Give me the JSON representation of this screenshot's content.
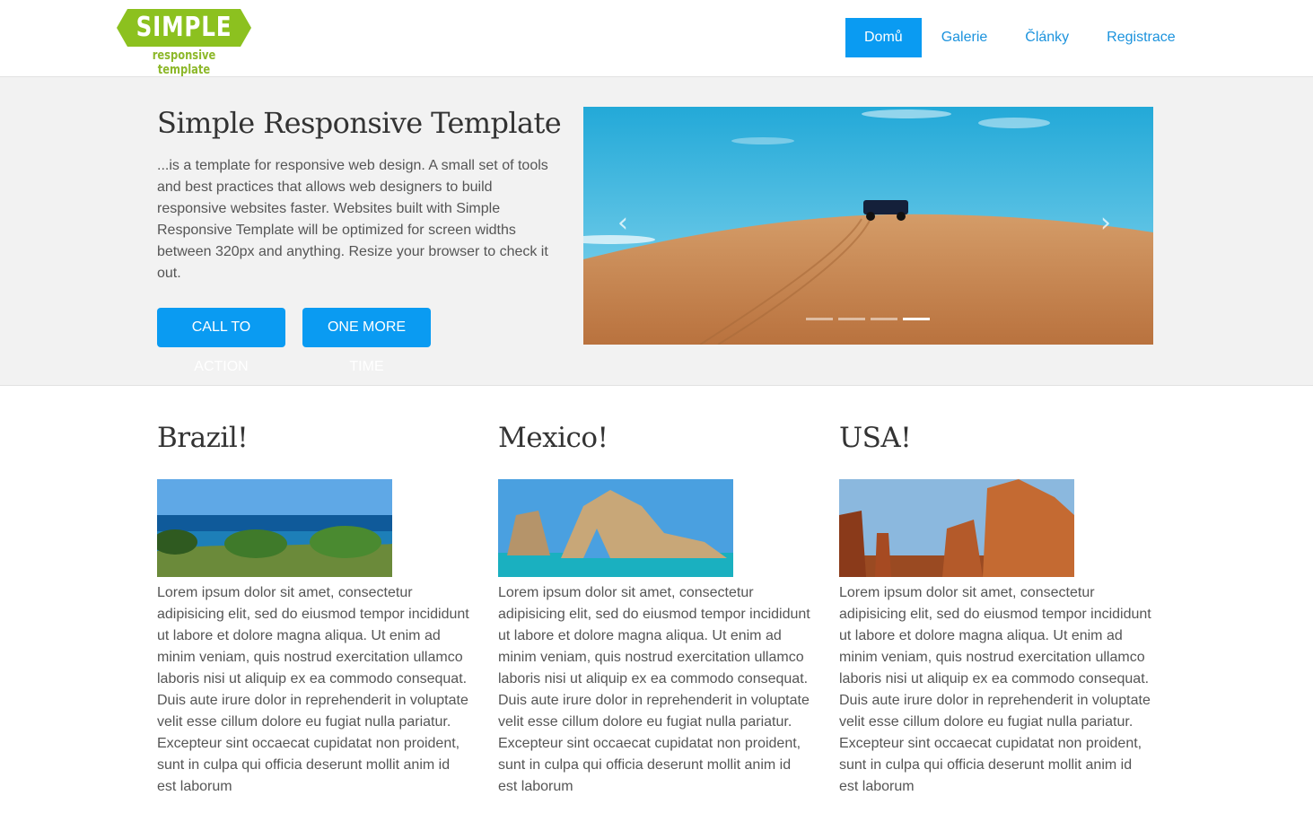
{
  "logo": {
    "word": "SIMPLE",
    "tagline": "responsive template",
    "badge_color": "#8cc11f"
  },
  "nav": {
    "items": [
      "Domů",
      "Galerie",
      "Články",
      "Registrace"
    ],
    "active_index": 0
  },
  "hero": {
    "title": "Simple Responsive Template",
    "text": "...is a template for responsive web design. A small set of tools and best practices that allows web designers to build responsive websites faster. Websites built with Simple Responsive Template will be optimized for screen widths between 320px and anything. Resize your browser to check it out.",
    "buttons": [
      "CALL TO ACTION",
      "ONE MORE TIME"
    ],
    "slider": {
      "prev_icon": "‹",
      "next_icon": "›",
      "slide_count": 4,
      "active_slide": 4
    }
  },
  "columns": [
    {
      "title": "Brazil!",
      "text": "Lorem ipsum dolor sit amet, consectetur adipisicing elit, sed do eiusmod tempor incididunt ut labore et dolore magna aliqua. Ut enim ad minim veniam, quis nostrud exercitation ullamco laboris nisi ut aliquip ex ea commodo consequat. Duis aute irure dolor in reprehenderit in voluptate velit esse cillum dolore eu fugiat nulla pariatur. Excepteur sint occaecat cupidatat non proident, sunt in culpa qui officia deserunt mollit anim id est laborum"
    },
    {
      "title": "Mexico!",
      "text": "Lorem ipsum dolor sit amet, consectetur adipisicing elit, sed do eiusmod tempor incididunt ut labore et dolore magna aliqua. Ut enim ad minim veniam, quis nostrud exercitation ullamco laboris nisi ut aliquip ex ea commodo consequat. Duis aute irure dolor in reprehenderit in voluptate velit esse cillum dolore eu fugiat nulla pariatur. Excepteur sint occaecat cupidatat non proident, sunt in culpa qui officia deserunt mollit anim id est laborum"
    },
    {
      "title": "USA!",
      "text": "Lorem ipsum dolor sit amet, consectetur adipisicing elit, sed do eiusmod tempor incididunt ut labore et dolore magna aliqua. Ut enim ad minim veniam, quis nostrud exercitation ullamco laboris nisi ut aliquip ex ea commodo consequat. Duis aute irure dolor in reprehenderit in voluptate velit esse cillum dolore eu fugiat nulla pariatur. Excepteur sint occaecat cupidatat non proident, sunt in culpa qui officia deserunt mollit anim id est laborum"
    }
  ],
  "colors": {
    "accent": "#0a9bf2",
    "nav_link": "#1c93dd",
    "hero_bg": "#f2f2f2",
    "text": "#555555",
    "heading": "#333333"
  }
}
